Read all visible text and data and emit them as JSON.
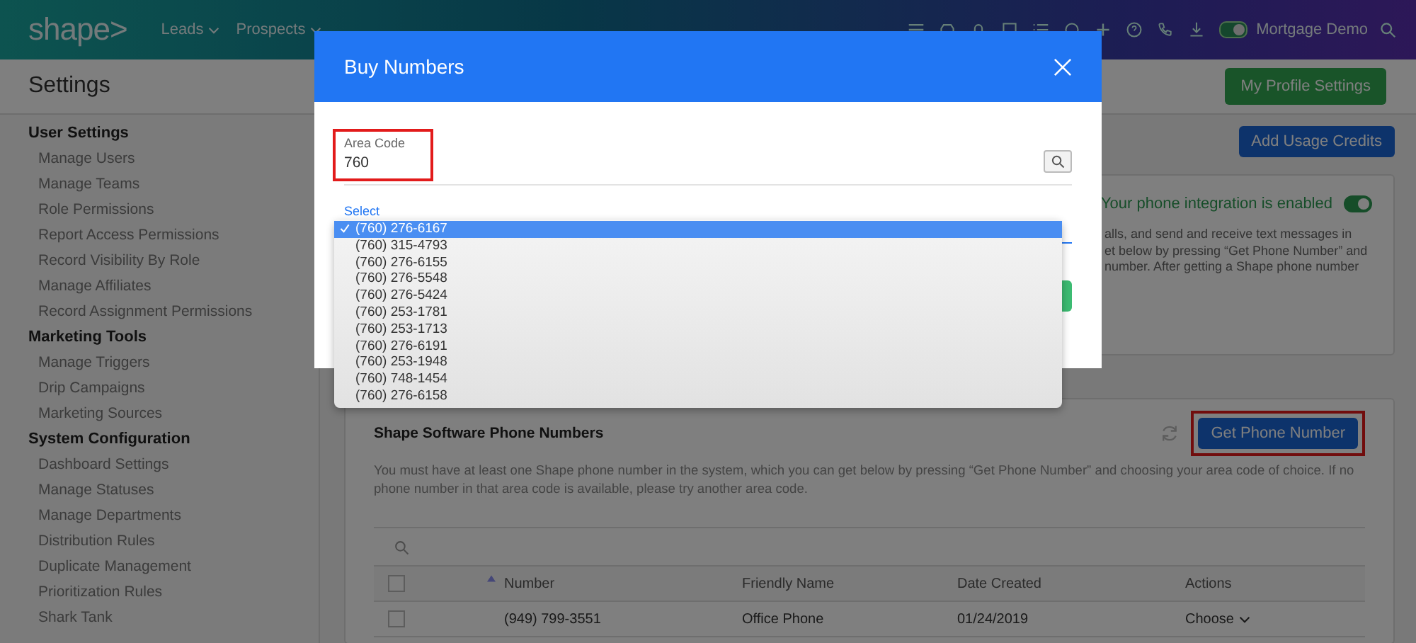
{
  "header": {
    "logo": "shape>",
    "nav": [
      {
        "label": "Leads",
        "has_menu": true
      },
      {
        "label": "Prospects",
        "has_menu": true
      }
    ],
    "toggle_on": true,
    "account": "Mortgage Demo"
  },
  "page": {
    "title": "Settings",
    "profile_button": "My Profile Settings",
    "usage_button": "Add Usage Credits"
  },
  "sidebar": [
    {
      "heading": "User Settings",
      "items": [
        "Manage Users",
        "Manage Teams",
        "Role Permissions",
        "Report Access Permissions",
        "Record Visibility By Role",
        "Manage Affiliates",
        "Record Assignment Permissions"
      ]
    },
    {
      "heading": "Marketing Tools",
      "items": [
        "Manage Triggers",
        "Drip Campaigns",
        "Marketing Sources"
      ]
    },
    {
      "heading": "System Configuration",
      "items": [
        "Dashboard Settings",
        "Manage Statuses",
        "Manage Departments",
        "Distribution Rules",
        "Duplicate Management",
        "Prioritization Rules",
        "Shark Tank"
      ]
    }
  ],
  "integration": {
    "status": "Your phone integration is enabled",
    "on": true,
    "text_lines": [
      "alls, and send and receive text messages in",
      "et below by pressing “Get Phone Number” and",
      "number. After getting a Shape phone number"
    ]
  },
  "numbers_card": {
    "title": "Shape Software Phone Numbers",
    "button": "Get Phone Number",
    "button_highlighted": true,
    "description": "You must have at least one Shape phone number in the system, which you can get below by pressing “Get Phone Number” and choosing your area code of choice. If no phone number in that area code is available, please try another area code.",
    "all_checked": false,
    "columns": [
      "Number",
      "Friendly Name",
      "Date Created",
      "Actions"
    ],
    "rows": [
      {
        "checked": false,
        "number": "(949) 799-3551",
        "friendly_name": "Office Phone",
        "date_created": "01/24/2019",
        "action": "Choose"
      }
    ]
  },
  "modal": {
    "title": "Buy Numbers",
    "area_code": {
      "label": "Area Code",
      "value": "760",
      "highlighted": true
    },
    "select_label": "Select",
    "options": [
      {
        "label": "(760) 276-6167",
        "selected": true
      },
      {
        "label": "(760) 315-4793",
        "selected": false
      },
      {
        "label": "(760) 276-6155",
        "selected": false
      },
      {
        "label": "(760) 276-5548",
        "selected": false
      },
      {
        "label": "(760) 276-5424",
        "selected": false
      },
      {
        "label": "(760) 253-1781",
        "selected": false
      },
      {
        "label": "(760) 253-1713",
        "selected": false
      },
      {
        "label": "(760) 276-6191",
        "selected": false
      },
      {
        "label": "(760) 253-1948",
        "selected": false
      },
      {
        "label": "(760) 748-1454",
        "selected": false
      },
      {
        "label": "(760) 276-6158",
        "selected": false
      }
    ]
  }
}
